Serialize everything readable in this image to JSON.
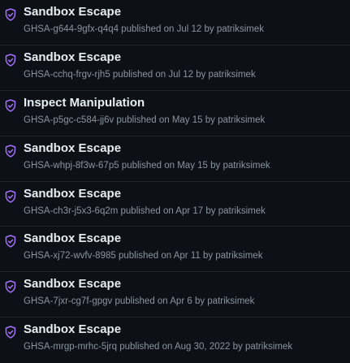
{
  "accent_color": "#a371f7",
  "advisories": [
    {
      "icon": "shield-icon",
      "title": "Sandbox Escape",
      "meta": "GHSA-g644-9gfx-q4q4 published on Jul 12 by patriksimek"
    },
    {
      "icon": "shield-icon",
      "title": "Sandbox Escape",
      "meta": "GHSA-cchq-frgv-rjh5 published on Jul 12 by patriksimek"
    },
    {
      "icon": "shield-icon",
      "title": "Inspect Manipulation",
      "meta": "GHSA-p5gc-c584-jj6v published on May 15 by patriksimek"
    },
    {
      "icon": "shield-icon",
      "title": "Sandbox Escape",
      "meta": "GHSA-whpj-8f3w-67p5 published on May 15 by patriksimek"
    },
    {
      "icon": "shield-icon",
      "title": "Sandbox Escape",
      "meta": "GHSA-ch3r-j5x3-6q2m published on Apr 17 by patriksimek"
    },
    {
      "icon": "shield-icon",
      "title": "Sandbox Escape",
      "meta": "GHSA-xj72-wvfv-8985 published on Apr 11 by patriksimek"
    },
    {
      "icon": "shield-icon",
      "title": "Sandbox Escape",
      "meta": "GHSA-7jxr-cg7f-gpgv published on Apr 6 by patriksimek"
    },
    {
      "icon": "shield-icon",
      "title": "Sandbox Escape",
      "meta": "GHSA-mrgp-mrhc-5jrq published on Aug 30, 2022 by patriksimek"
    }
  ]
}
